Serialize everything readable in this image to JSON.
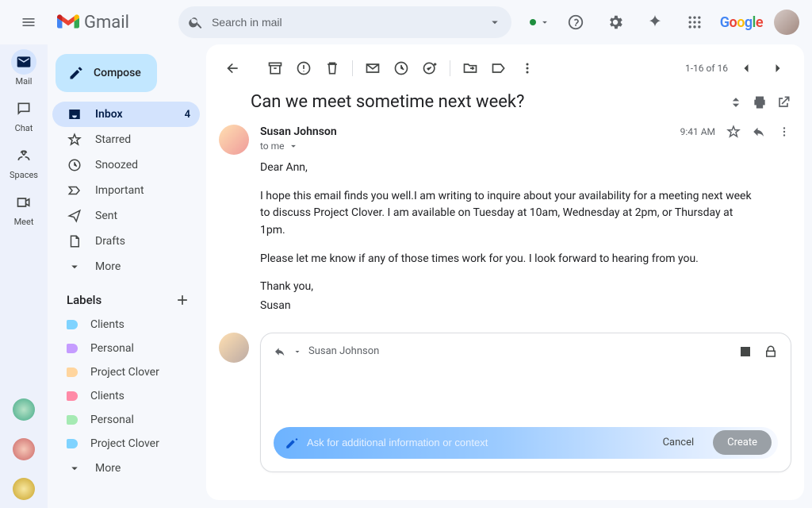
{
  "brand": {
    "name": "Gmail"
  },
  "search": {
    "placeholder": "Search in mail"
  },
  "rail": {
    "items": [
      {
        "label": "Mail"
      },
      {
        "label": "Chat"
      },
      {
        "label": "Spaces"
      },
      {
        "label": "Meet"
      }
    ]
  },
  "compose": {
    "label": "Compose"
  },
  "nav": {
    "items": [
      {
        "label": "Inbox",
        "count": "4"
      },
      {
        "label": "Starred"
      },
      {
        "label": "Snoozed"
      },
      {
        "label": "Important"
      },
      {
        "label": "Sent"
      },
      {
        "label": "Drafts"
      },
      {
        "label": "More"
      }
    ]
  },
  "labels": {
    "header": "Labels",
    "items": [
      {
        "label": "Clients",
        "color": "#7fd3ff"
      },
      {
        "label": "Personal",
        "color": "#c59cff"
      },
      {
        "label": "Project Clover",
        "color": "#ffd59e"
      },
      {
        "label": "Clients",
        "color": "#ff8aa7"
      },
      {
        "label": "Personal",
        "color": "#a5eab3"
      },
      {
        "label": "Project Clover",
        "color": "#7fd3ff"
      }
    ],
    "more": "More"
  },
  "toolbar": {
    "count": "1-16 of 16"
  },
  "message": {
    "subject": "Can we meet sometime next week?",
    "sender": "Susan Johnson",
    "to": "to me",
    "time": "9:41 AM",
    "body": {
      "greeting": "Dear Ann,",
      "p1": "I hope this email finds you well.I am writing to inquire about your availability for a meeting next week to discuss Project Clover. I am available on Tuesday at 10am, Wednesday at 2pm, or Thursday at 1pm.",
      "p2": "Please let me know if any of those times work for you. I look forward to hearing from you.",
      "thanks": "Thank you,",
      "sign": "Susan"
    }
  },
  "reply": {
    "to": "Susan Johnson"
  },
  "ai": {
    "placeholder": "Ask for additional information or context",
    "cancel": "Cancel",
    "create": "Create"
  },
  "google": "Google"
}
